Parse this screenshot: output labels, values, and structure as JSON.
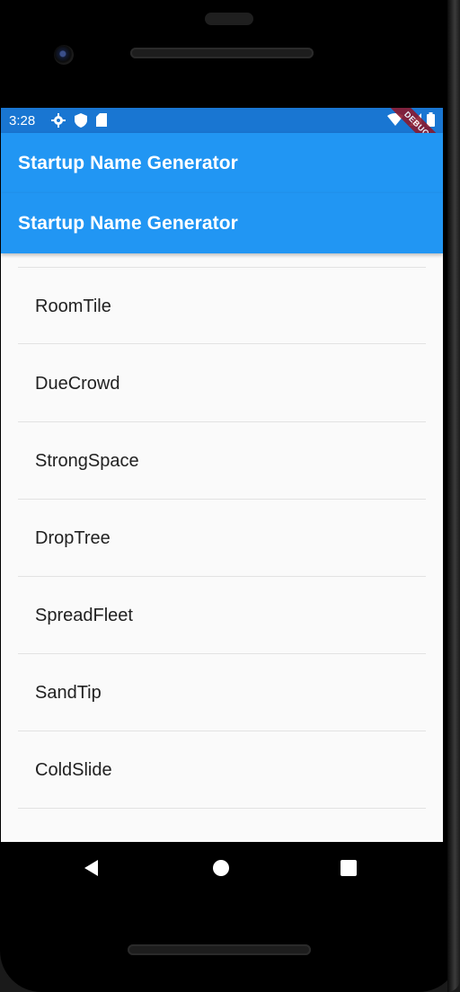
{
  "status_bar": {
    "time": "3:28",
    "left_icons": [
      "gear-icon",
      "shield-icon",
      "sd-card-icon"
    ],
    "right_icons": [
      "wifi-icon",
      "signal-icon",
      "battery-icon"
    ]
  },
  "debug_banner": "DEBUG",
  "app_bars": [
    {
      "title": "Startup Name Generator"
    },
    {
      "title": "Startup Name Generator"
    }
  ],
  "list": {
    "items": [
      {
        "label": "RoomTile"
      },
      {
        "label": "DueCrowd"
      },
      {
        "label": "StrongSpace"
      },
      {
        "label": "DropTree"
      },
      {
        "label": "SpreadFleet"
      },
      {
        "label": "SandTip"
      },
      {
        "label": "ColdSlide"
      }
    ]
  },
  "nav_bar": {
    "buttons": [
      "back-icon",
      "home-icon",
      "recents-icon"
    ]
  },
  "colors": {
    "status_bar": "#1976d2",
    "app_bar": "#2196f3",
    "list_background": "#fafafa"
  }
}
